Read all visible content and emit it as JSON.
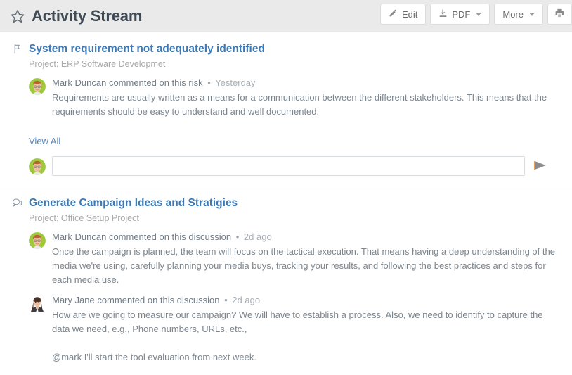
{
  "header": {
    "title": "Activity Stream",
    "favorite_icon": "star-outline-icon",
    "toolbar": {
      "edit_label": "Edit",
      "edit_icon": "pencil-icon",
      "pdf_label": "PDF",
      "pdf_icon": "download-icon",
      "more_label": "More",
      "print_icon": "print-icon"
    }
  },
  "activities": [
    {
      "type_icon": "flag-risk-icon",
      "title": "System requirement not adequately identified",
      "project": "Project: ERP Software Developmet",
      "comments": [
        {
          "avatar": "avatar-mark-duncan",
          "author": "Mark Duncan",
          "action": "commented on this risk",
          "separator": "•",
          "time": "Yesterday",
          "paragraphs": [
            "Requirements are usually written as a means for a communication between the different stakeholders. This means that the requirements should be easy to understand and well documented."
          ]
        }
      ],
      "view_all_label": "View All",
      "composer": {
        "avatar": "avatar-mark-duncan",
        "value": "",
        "placeholder": "",
        "send_icon": "send-arrow-icon"
      }
    },
    {
      "type_icon": "discussion-bubble-icon",
      "title": "Generate Campaign Ideas and Stratigies",
      "project": "Project: Office Setup Project",
      "comments": [
        {
          "avatar": "avatar-mark-duncan",
          "author": "Mark Duncan",
          "action": "commented on this discussion",
          "separator": "•",
          "time": "2d ago",
          "paragraphs": [
            "Once the campaign is planned, the team will focus on the tactical execution. That means having a deep understanding of the media we're using, carefully planning your media buys, tracking your results, and following the best practices and steps for each media use."
          ]
        },
        {
          "avatar": "avatar-mary-jane",
          "author": "Mary Jane",
          "action": "commented on this discussion",
          "separator": "•",
          "time": "2d ago",
          "paragraphs": [
            "How are we going to measure our campaign? We will have to establish a process. Also, we need to identify to capture the data we need, e.g., Phone numbers, URLs, etc.,",
            "@mark I'll start the tool evaluation from next week."
          ]
        }
      ]
    }
  ],
  "colors": {
    "header_bg": "#eaeaea",
    "title_text": "#3f4a55",
    "link_blue": "#3d7ab5",
    "muted_text": "#a9a9a9",
    "body_text": "#7b858e",
    "border": "#e8e8e8"
  }
}
